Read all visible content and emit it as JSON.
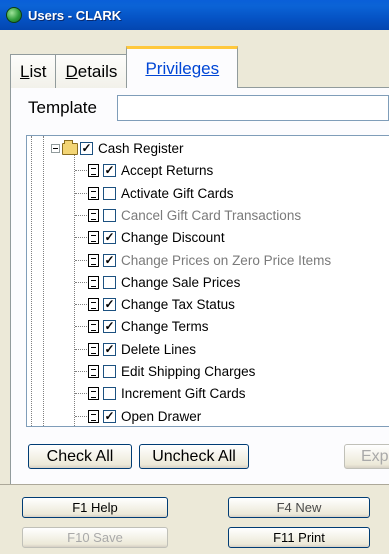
{
  "window": {
    "title": "Users - CLARK"
  },
  "tabs": [
    {
      "label": "List",
      "underline_first": true,
      "active": false
    },
    {
      "label": "Details",
      "underline_first": true,
      "active": false
    },
    {
      "label": "Privileges",
      "underline_first": false,
      "active": true
    }
  ],
  "template": {
    "label": "Template",
    "value": ""
  },
  "tree": {
    "root": {
      "label": "Cash Register",
      "checked": true,
      "expanded": true
    },
    "items": [
      {
        "label": "Accept Returns",
        "checked": true,
        "enabled": true
      },
      {
        "label": "Activate Gift Cards",
        "checked": false,
        "enabled": true
      },
      {
        "label": "Cancel Gift Card Transactions",
        "checked": false,
        "enabled": false
      },
      {
        "label": "Change Discount",
        "checked": true,
        "enabled": true
      },
      {
        "label": "Change Prices on Zero Price Items",
        "checked": true,
        "enabled": false
      },
      {
        "label": "Change Sale Prices",
        "checked": false,
        "enabled": true
      },
      {
        "label": "Change Tax Status",
        "checked": true,
        "enabled": true
      },
      {
        "label": "Change Terms",
        "checked": true,
        "enabled": true
      },
      {
        "label": "Delete Lines",
        "checked": true,
        "enabled": true
      },
      {
        "label": "Edit Shipping Charges",
        "checked": false,
        "enabled": true
      },
      {
        "label": "Increment Gift Cards",
        "checked": false,
        "enabled": true
      },
      {
        "label": "Open Drawer",
        "checked": true,
        "enabled": true
      }
    ]
  },
  "buttons": {
    "check_all": "Check All",
    "uncheck_all": "Uncheck All",
    "expand": "Exp",
    "f1_help": "F1 Help",
    "f4_new": "F4 New",
    "f10_save": "F10 Save",
    "f11_print": "F11 Print"
  }
}
